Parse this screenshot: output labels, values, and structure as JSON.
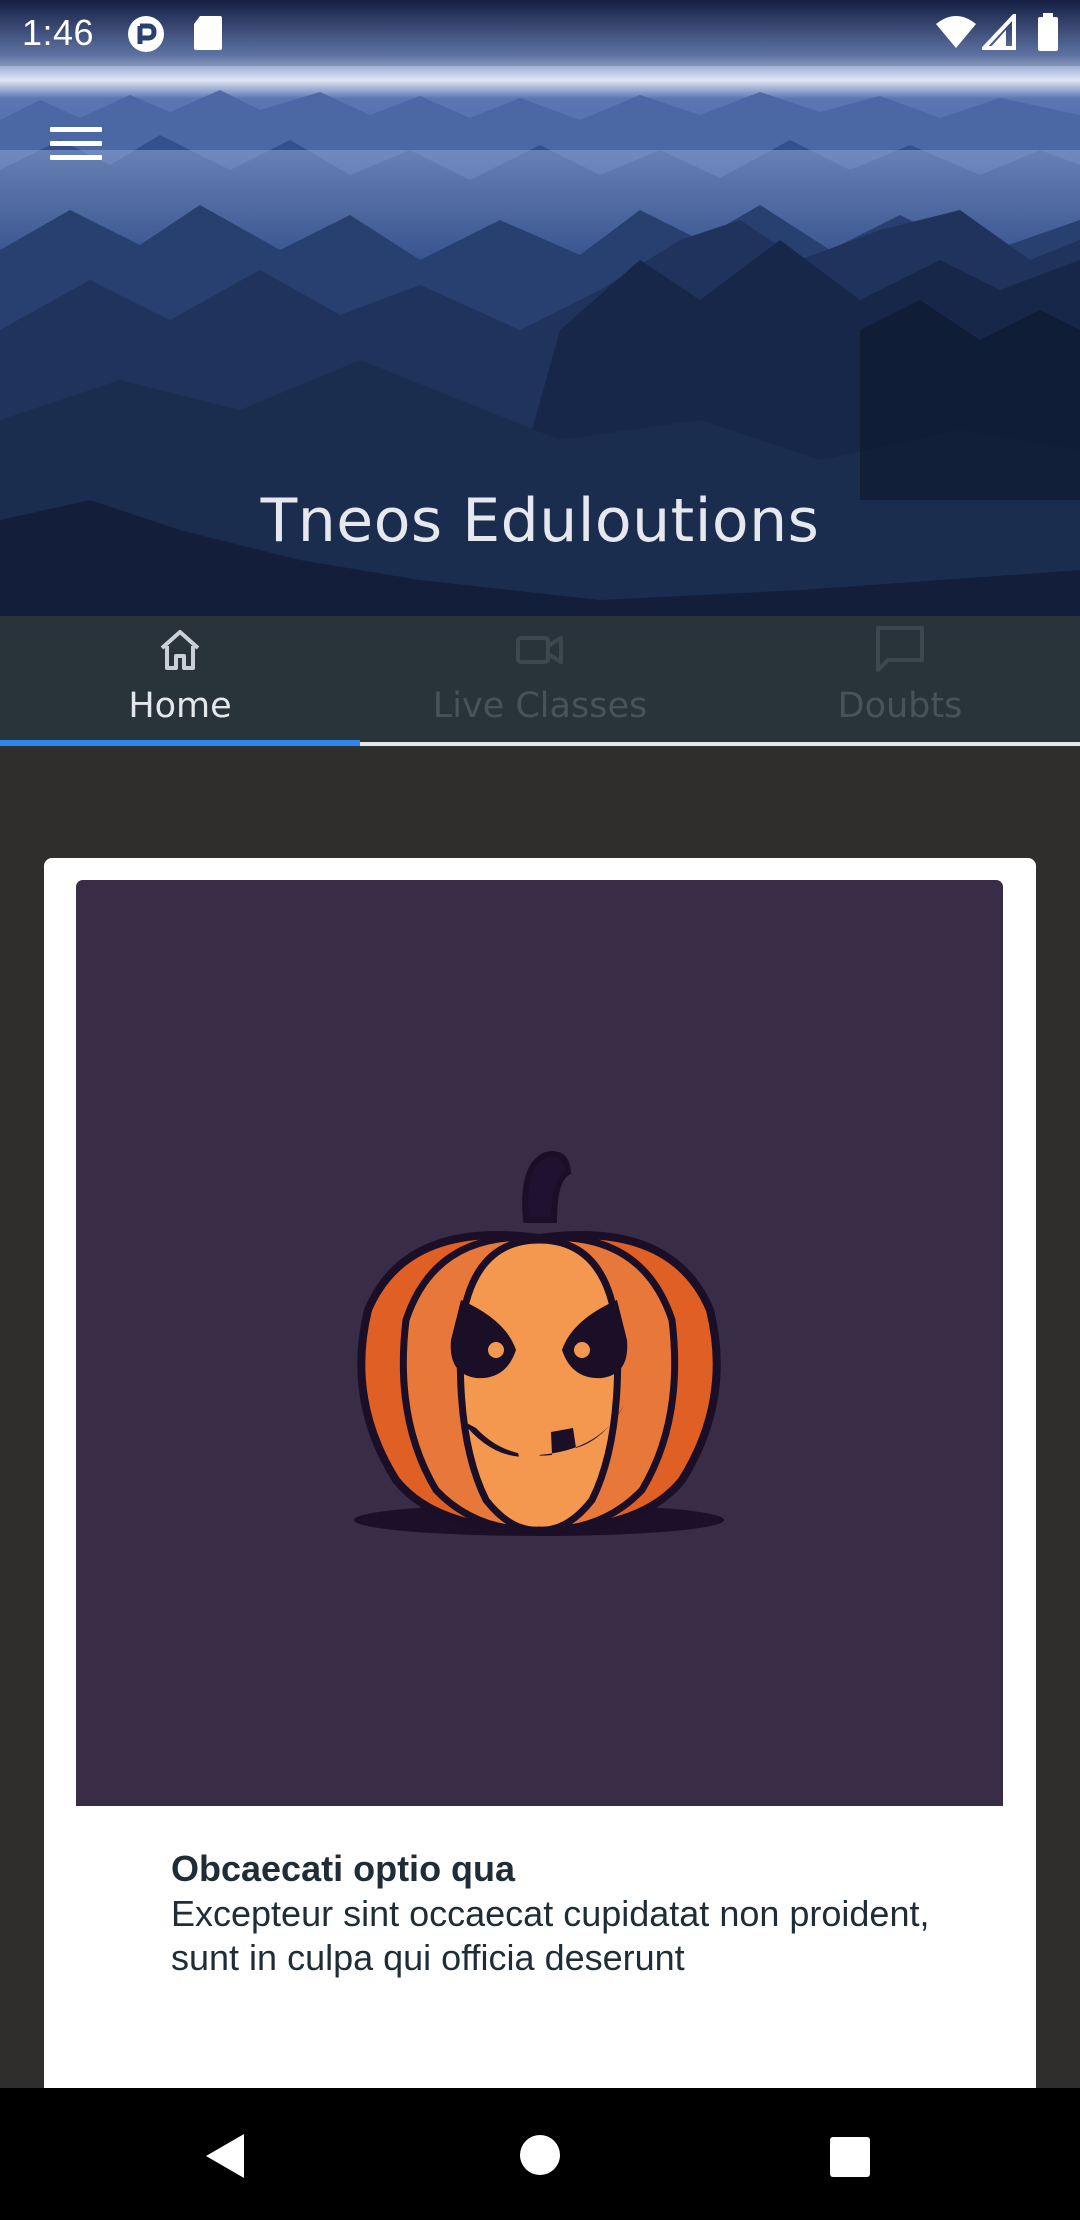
{
  "status_bar": {
    "time": "1:46",
    "icons": [
      "notification-badge-icon",
      "sd-card-icon",
      "wifi-icon",
      "cellular-signal-icon",
      "battery-icon"
    ]
  },
  "header": {
    "menu_icon": "hamburger-menu-icon",
    "title": "Tneos Eduloutions"
  },
  "tabs": [
    {
      "label": "Home",
      "icon": "home-icon",
      "selected": true
    },
    {
      "label": "Live Classes",
      "icon": "video-camera-icon",
      "selected": false
    },
    {
      "label": "Doubts",
      "icon": "chat-bubble-icon",
      "selected": false
    }
  ],
  "card": {
    "image": "jack-o-lantern-pumpkin",
    "title": "Obcaecati optio qua",
    "body": "Excepteur sint occaecat cupidatat non proident, sunt in culpa qui officia deserunt"
  },
  "nav_bar": {
    "back": "back-triangle-icon",
    "home": "home-circle-icon",
    "recents": "recents-square-icon"
  },
  "colors": {
    "tab_bar_bg": "#29333a",
    "tab_indicator": "#2f86e8",
    "page_bg": "#2f2e2c",
    "card_image_bg": "#382c46",
    "text_dark": "#1e2d36"
  }
}
